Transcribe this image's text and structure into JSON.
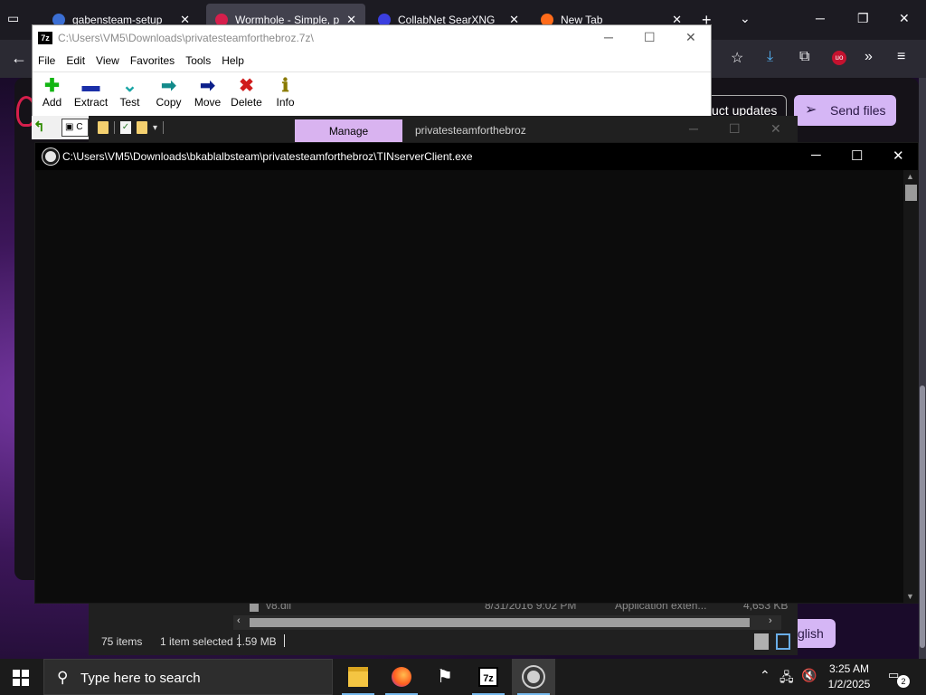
{
  "browser": {
    "tabs": [
      {
        "title": "gabensteam-setup",
        "favicon_color": "#3b6fd4"
      },
      {
        "title": "Wormhole - Simple, p",
        "favicon_color": "#d61f4c"
      },
      {
        "title": "CollabNet SearXNG",
        "favicon_color": "#3b3fe0"
      },
      {
        "title": "New Tab",
        "favicon_color": "#ff6b1a"
      }
    ],
    "close_glyph": "✕",
    "new_tab_glyph": "+",
    "page": {
      "updates_button": "uct updates",
      "send_files_button": "Send files",
      "language_button": "glish"
    }
  },
  "sevenzip": {
    "app_icon": "7z",
    "title": "C:\\Users\\VM5\\Downloads\\privatesteamforthebroz.7z\\",
    "menu": [
      "File",
      "Edit",
      "View",
      "Favorites",
      "Tools",
      "Help"
    ],
    "toolbar": [
      {
        "label": "Add",
        "icon": "plus-icon",
        "glyph": "✚",
        "color": "#13b513"
      },
      {
        "label": "Extract",
        "icon": "minus-icon",
        "glyph": "▬",
        "color": "#1a2fa8"
      },
      {
        "label": "Test",
        "icon": "check-chevron-icon",
        "glyph": "⌄",
        "color": "#1aa5a5"
      },
      {
        "label": "Copy",
        "icon": "arrow-right-icon",
        "glyph": "➡",
        "color": "#128a8a"
      },
      {
        "label": "Move",
        "icon": "arrow-right-icon",
        "glyph": "➡",
        "color": "#0b1f8a"
      },
      {
        "label": "Delete",
        "icon": "x-icon",
        "glyph": "✖",
        "color": "#d01c1c"
      },
      {
        "label": "Info",
        "icon": "info-icon",
        "glyph": "ℹ",
        "color": "#8a7a00"
      }
    ],
    "address_prefix": "C"
  },
  "explorer": {
    "manage_tab": "Manage",
    "title": "privatesteamforthebroz",
    "last_row": {
      "name": "v8.dll",
      "date": "8/31/2016 9:02 PM",
      "type": "Application exten...",
      "size": "4,653 KB"
    },
    "status": {
      "items": "75 items",
      "selected": "1 item selected",
      "size": "1.59 MB"
    }
  },
  "console": {
    "title": "C:\\Users\\VM5\\Downloads\\bkablalbsteam\\privatesteamforthebroz\\TINserverClient.exe"
  },
  "taskbar": {
    "search_placeholder": "Type here to search",
    "apps": [
      "file-explorer",
      "firefox",
      "windows-flag",
      "7-zip",
      "steam"
    ],
    "time": "3:25 AM",
    "date": "1/2/2025",
    "notifications_count": "2"
  },
  "colors": {
    "manage_tab": "#d9b3f0",
    "send_files_button": "#d5b6f5",
    "console_bg": "#0c0c0c"
  }
}
